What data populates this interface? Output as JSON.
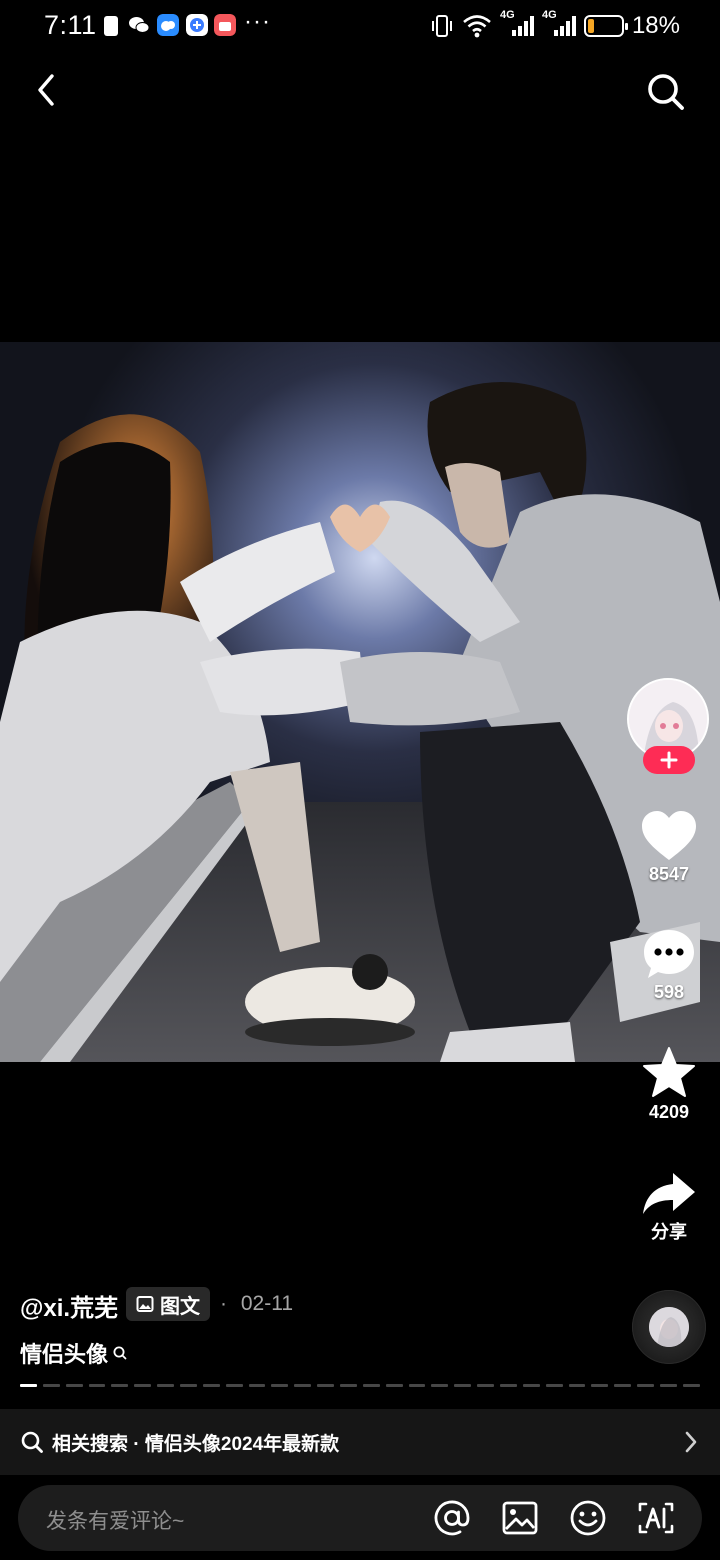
{
  "status_bar": {
    "time": "7:11",
    "overflow": "···",
    "network_a": "4G",
    "network_b": "4G",
    "battery_percent": "18%",
    "battery_level": 0.18,
    "battery_color": "#f5a623"
  },
  "nav": {
    "back_icon": "chevron-left-icon",
    "search_icon": "search-icon"
  },
  "post": {
    "author": "@xi.荒芜",
    "type_label": "图文",
    "date_sep": "·",
    "date": "02-11",
    "caption": "情侣头像",
    "image_count": 30,
    "current_image": 1
  },
  "actions": {
    "likes": "8547",
    "comments": "598",
    "favorites": "4209",
    "share_label": "分享",
    "follow_icon": "plus-icon",
    "accent": "#fe2c55"
  },
  "related": {
    "label": "相关搜索 · 情侣头像2024年最新款"
  },
  "comment": {
    "placeholder": "发条有爱评论~",
    "icons": [
      "at-icon",
      "image-icon",
      "emoji-icon",
      "ai-icon"
    ]
  }
}
